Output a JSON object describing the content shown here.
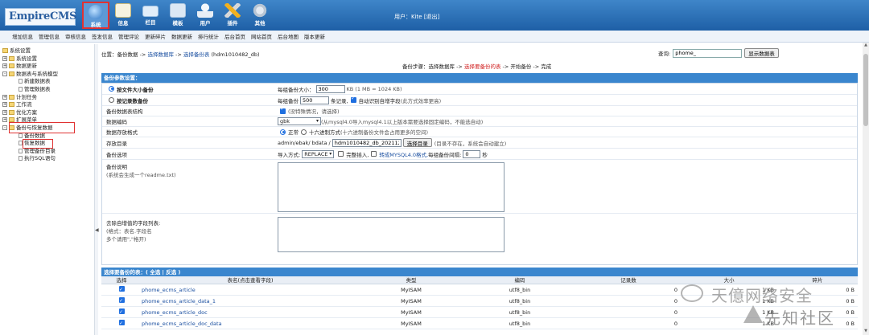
{
  "logo": {
    "text": "EmpireCMS"
  },
  "topnav": [
    {
      "label": "系统",
      "icon": "globe-icon",
      "active": true
    },
    {
      "label": "信息",
      "icon": "document-icon"
    },
    {
      "label": "栏目",
      "icon": "folder-icon"
    },
    {
      "label": "模板",
      "icon": "template-icon"
    },
    {
      "label": "用户",
      "icon": "user-icon"
    },
    {
      "label": "插件",
      "icon": "plugin-icon"
    },
    {
      "label": "其他",
      "icon": "gear-icon"
    }
  ],
  "user": {
    "prefix": "用户：",
    "name": "Kite",
    "logout": "[退出]"
  },
  "submenu": [
    "增加信息",
    "管理信息",
    "审核信息",
    "签发信息",
    "管理评论",
    "更新碎片",
    "数据更新",
    "排行统计",
    "后台首页",
    "网站首页",
    "后台地图",
    "版本更新"
  ],
  "tree": [
    {
      "pm": "",
      "icon": "home",
      "label": "系统设置",
      "level": 0
    },
    {
      "pm": "+",
      "icon": "folder",
      "label": "系统设置",
      "level": 1
    },
    {
      "pm": "+",
      "icon": "folder",
      "label": "数据更新",
      "level": 1
    },
    {
      "pm": "-",
      "icon": "folder",
      "label": "数据表与系统模型",
      "level": 1
    },
    {
      "pm": "",
      "icon": "page",
      "label": "新建数据表",
      "level": 2
    },
    {
      "pm": "",
      "icon": "page",
      "label": "管理数据表",
      "level": 2
    },
    {
      "pm": "+",
      "icon": "folder",
      "label": "计划任务",
      "level": 1
    },
    {
      "pm": "+",
      "icon": "folder",
      "label": "工作流",
      "level": 1
    },
    {
      "pm": "+",
      "icon": "folder",
      "label": "优化方案",
      "level": 1
    },
    {
      "pm": "+",
      "icon": "folder",
      "label": "扩展菜单",
      "level": 1
    },
    {
      "pm": "-",
      "icon": "folder",
      "label": "备份与恢复数据",
      "level": 1,
      "highlight": true
    },
    {
      "pm": "",
      "icon": "page",
      "label": "备份数据",
      "level": 2
    },
    {
      "pm": "",
      "icon": "page",
      "label": "恢复数据",
      "level": 2,
      "highlight": true
    },
    {
      "pm": "",
      "icon": "page",
      "label": "管理备份目录",
      "level": 2
    },
    {
      "pm": "",
      "icon": "page",
      "label": "执行SQL语句",
      "level": 2
    }
  ],
  "breadcrumb": {
    "prefix": "位置：备份数据 -> ",
    "link1": "选择数据库",
    "mid": " -> ",
    "link2": "选择备份表",
    "suffix": " (hdm1010482_db)"
  },
  "search": {
    "label": "查询:",
    "value": "phome_",
    "button": "显示数据表"
  },
  "steps": {
    "prefix": "备份步骤：选择数据库 -> ",
    "current": "选择要备份的表",
    "suffix": " -> 开始备份 -> 完成"
  },
  "section1": {
    "title": "备份参数设置："
  },
  "form": {
    "by_size": {
      "label": "按文件大小备份",
      "text1": "每组备份大小：",
      "value": "300",
      "text2": "KB (1 MB = 1024 KB)"
    },
    "by_record": {
      "label": "按记录数备份",
      "text1": "每组备份",
      "value": "500",
      "text2": "条记录,",
      "auto": "自动识别自增字段",
      "auto_note": "(此方式效率更高)"
    },
    "struct": {
      "label": "备份数据表结构",
      "note": "(没特殊情况，请选择)"
    },
    "encoding": {
      "label": "数据编码",
      "value": "gbk",
      "note": "(从mysql4.0导入mysql4.1以上版本需要选择固定编码，不能选自动)"
    },
    "store": {
      "label": "数据存放格式",
      "opt1": "正常",
      "opt2": "十六进制方式",
      "opt2_note": "(十六进制备份文件会占用更多的空间)"
    },
    "dir": {
      "label": "存放目录",
      "prefix": "admin/ebak/ bdata /",
      "value": "hdm1010482_db_2021122",
      "button": "选择目录",
      "note": "(目录不存在，系统会自动建立)"
    },
    "options": {
      "label": "备份选项",
      "import": "导入方式:",
      "mode": "REPLACE",
      "full": "完整插入,",
      "convert": "转成MYSQL4.0格式,",
      "interval": "每组备份间隔:",
      "interval_value": "0",
      "sec": "秒"
    },
    "desc": {
      "label": "备份说明",
      "sub": "(系统会生成一个readme.txt)"
    },
    "exclude": {
      "label": "去除自增值的字段列表:",
      "sub1": "(格式：表名.字段名",
      "sub2": "多个请用\",\"格开)"
    }
  },
  "section2": {
    "title_prefix": "选择要备份的表：( ",
    "select_all": "全选",
    "sep": " | ",
    "invert": "反选",
    "title_suffix": " )"
  },
  "table": {
    "headers": [
      "选择",
      "表名(点击查看字段)",
      "类型",
      "编码",
      "记录数",
      "大小",
      "碎片"
    ],
    "rows": [
      {
        "name": "phome_ecms_article",
        "type": "MyISAM",
        "enc": "utf8_bin",
        "records": "0",
        "size": "1 KB",
        "frag": "0 B"
      },
      {
        "name": "phome_ecms_article_data_1",
        "type": "MyISAM",
        "enc": "utf8_bin",
        "records": "0",
        "size": "1 KB",
        "frag": "0 B"
      },
      {
        "name": "phome_ecms_article_doc",
        "type": "MyISAM",
        "enc": "utf8_bin",
        "records": "0",
        "size": "1 KB",
        "frag": "0 B"
      },
      {
        "name": "phome_ecms_article_doc_data",
        "type": "MyISAM",
        "enc": "utf8_bin",
        "records": "0",
        "size": "1 KB",
        "frag": "0 B"
      }
    ]
  },
  "watermark": {
    "line1": "天億网络安全",
    "line2": "先知社区"
  },
  "collapse_arrow": "◀"
}
